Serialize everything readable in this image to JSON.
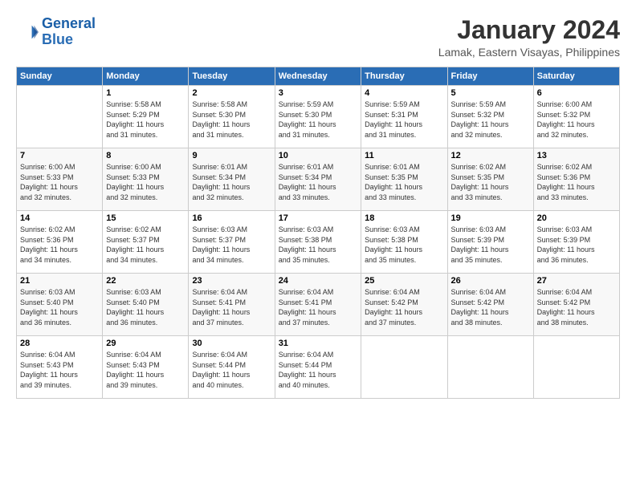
{
  "logo": {
    "line1": "General",
    "line2": "Blue"
  },
  "title": "January 2024",
  "subtitle": "Lamak, Eastern Visayas, Philippines",
  "headers": [
    "Sunday",
    "Monday",
    "Tuesday",
    "Wednesday",
    "Thursday",
    "Friday",
    "Saturday"
  ],
  "weeks": [
    [
      {
        "day": "",
        "detail": ""
      },
      {
        "day": "1",
        "detail": "Sunrise: 5:58 AM\nSunset: 5:29 PM\nDaylight: 11 hours\nand 31 minutes."
      },
      {
        "day": "2",
        "detail": "Sunrise: 5:58 AM\nSunset: 5:30 PM\nDaylight: 11 hours\nand 31 minutes."
      },
      {
        "day": "3",
        "detail": "Sunrise: 5:59 AM\nSunset: 5:30 PM\nDaylight: 11 hours\nand 31 minutes."
      },
      {
        "day": "4",
        "detail": "Sunrise: 5:59 AM\nSunset: 5:31 PM\nDaylight: 11 hours\nand 31 minutes."
      },
      {
        "day": "5",
        "detail": "Sunrise: 5:59 AM\nSunset: 5:32 PM\nDaylight: 11 hours\nand 32 minutes."
      },
      {
        "day": "6",
        "detail": "Sunrise: 6:00 AM\nSunset: 5:32 PM\nDaylight: 11 hours\nand 32 minutes."
      }
    ],
    [
      {
        "day": "7",
        "detail": "Sunrise: 6:00 AM\nSunset: 5:33 PM\nDaylight: 11 hours\nand 32 minutes."
      },
      {
        "day": "8",
        "detail": "Sunrise: 6:00 AM\nSunset: 5:33 PM\nDaylight: 11 hours\nand 32 minutes."
      },
      {
        "day": "9",
        "detail": "Sunrise: 6:01 AM\nSunset: 5:34 PM\nDaylight: 11 hours\nand 32 minutes."
      },
      {
        "day": "10",
        "detail": "Sunrise: 6:01 AM\nSunset: 5:34 PM\nDaylight: 11 hours\nand 33 minutes."
      },
      {
        "day": "11",
        "detail": "Sunrise: 6:01 AM\nSunset: 5:35 PM\nDaylight: 11 hours\nand 33 minutes."
      },
      {
        "day": "12",
        "detail": "Sunrise: 6:02 AM\nSunset: 5:35 PM\nDaylight: 11 hours\nand 33 minutes."
      },
      {
        "day": "13",
        "detail": "Sunrise: 6:02 AM\nSunset: 5:36 PM\nDaylight: 11 hours\nand 33 minutes."
      }
    ],
    [
      {
        "day": "14",
        "detail": "Sunrise: 6:02 AM\nSunset: 5:36 PM\nDaylight: 11 hours\nand 34 minutes."
      },
      {
        "day": "15",
        "detail": "Sunrise: 6:02 AM\nSunset: 5:37 PM\nDaylight: 11 hours\nand 34 minutes."
      },
      {
        "day": "16",
        "detail": "Sunrise: 6:03 AM\nSunset: 5:37 PM\nDaylight: 11 hours\nand 34 minutes."
      },
      {
        "day": "17",
        "detail": "Sunrise: 6:03 AM\nSunset: 5:38 PM\nDaylight: 11 hours\nand 35 minutes."
      },
      {
        "day": "18",
        "detail": "Sunrise: 6:03 AM\nSunset: 5:38 PM\nDaylight: 11 hours\nand 35 minutes."
      },
      {
        "day": "19",
        "detail": "Sunrise: 6:03 AM\nSunset: 5:39 PM\nDaylight: 11 hours\nand 35 minutes."
      },
      {
        "day": "20",
        "detail": "Sunrise: 6:03 AM\nSunset: 5:39 PM\nDaylight: 11 hours\nand 36 minutes."
      }
    ],
    [
      {
        "day": "21",
        "detail": "Sunrise: 6:03 AM\nSunset: 5:40 PM\nDaylight: 11 hours\nand 36 minutes."
      },
      {
        "day": "22",
        "detail": "Sunrise: 6:03 AM\nSunset: 5:40 PM\nDaylight: 11 hours\nand 36 minutes."
      },
      {
        "day": "23",
        "detail": "Sunrise: 6:04 AM\nSunset: 5:41 PM\nDaylight: 11 hours\nand 37 minutes."
      },
      {
        "day": "24",
        "detail": "Sunrise: 6:04 AM\nSunset: 5:41 PM\nDaylight: 11 hours\nand 37 minutes."
      },
      {
        "day": "25",
        "detail": "Sunrise: 6:04 AM\nSunset: 5:42 PM\nDaylight: 11 hours\nand 37 minutes."
      },
      {
        "day": "26",
        "detail": "Sunrise: 6:04 AM\nSunset: 5:42 PM\nDaylight: 11 hours\nand 38 minutes."
      },
      {
        "day": "27",
        "detail": "Sunrise: 6:04 AM\nSunset: 5:42 PM\nDaylight: 11 hours\nand 38 minutes."
      }
    ],
    [
      {
        "day": "28",
        "detail": "Sunrise: 6:04 AM\nSunset: 5:43 PM\nDaylight: 11 hours\nand 39 minutes."
      },
      {
        "day": "29",
        "detail": "Sunrise: 6:04 AM\nSunset: 5:43 PM\nDaylight: 11 hours\nand 39 minutes."
      },
      {
        "day": "30",
        "detail": "Sunrise: 6:04 AM\nSunset: 5:44 PM\nDaylight: 11 hours\nand 40 minutes."
      },
      {
        "day": "31",
        "detail": "Sunrise: 6:04 AM\nSunset: 5:44 PM\nDaylight: 11 hours\nand 40 minutes."
      },
      {
        "day": "",
        "detail": ""
      },
      {
        "day": "",
        "detail": ""
      },
      {
        "day": "",
        "detail": ""
      }
    ]
  ]
}
